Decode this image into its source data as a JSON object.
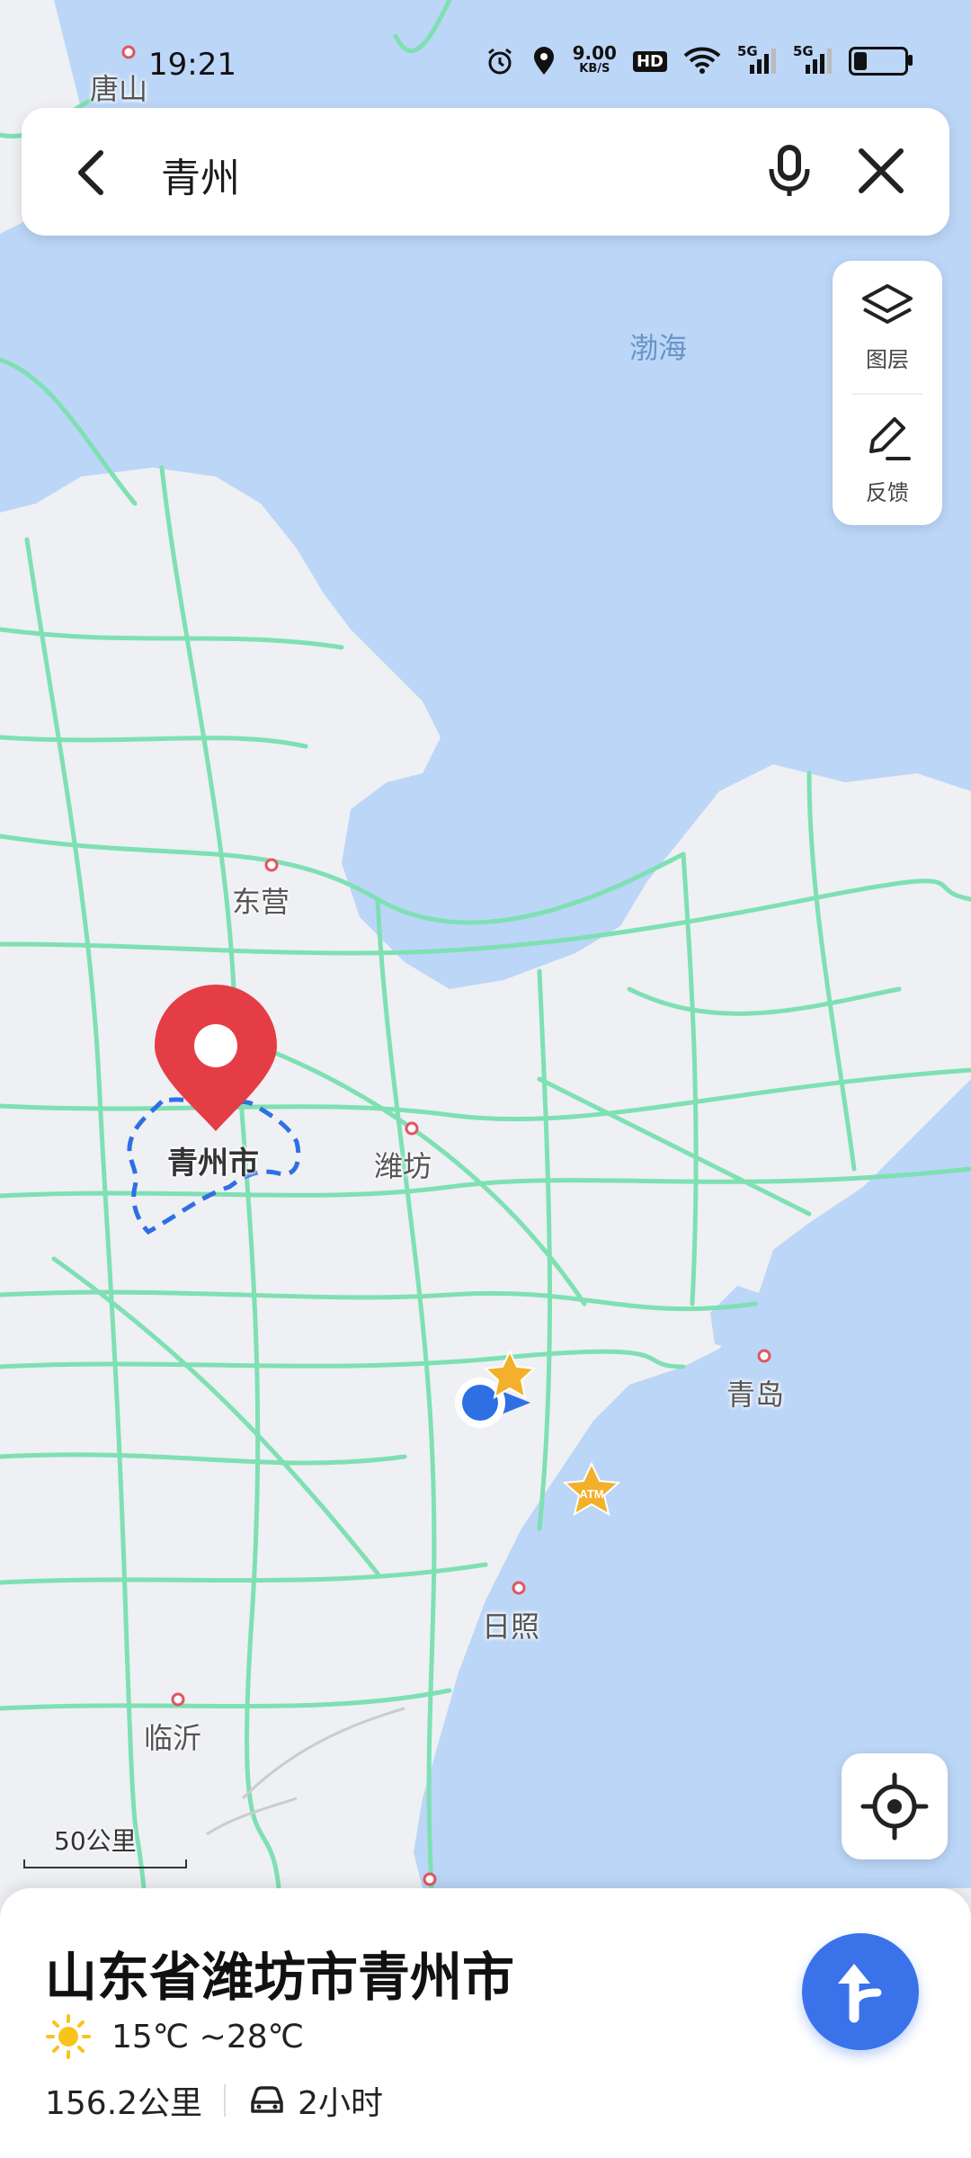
{
  "status_bar": {
    "time": "19:21",
    "net_speed_value": "9.00",
    "net_speed_unit": "KB/S",
    "hd_label": "HD",
    "network_1": "5G",
    "network_2": "5G",
    "battery_level": 0.25
  },
  "search": {
    "query": "青州"
  },
  "side_panel": {
    "layers_label": "图层",
    "feedback_label": "反馈"
  },
  "map": {
    "labels": {
      "tangshan": "唐山",
      "bohai": "渤海",
      "dongying": "东营",
      "qingzhou": "青州市",
      "weifang": "潍坊",
      "qingdao": "青岛",
      "rizhao": "日照",
      "linyi": "临沂"
    },
    "atm_badge": "ATM",
    "scale_label": "50公里",
    "colors": {
      "land": "#eef0f3",
      "sea": "#bcd6f7",
      "road": "#7ee0b3",
      "pin": "#e53d45",
      "boundary": "#2f6fe4",
      "accent": "#3a72ea"
    }
  },
  "place_card": {
    "title": "山东省潍坊市青州市",
    "weather": "15℃ ~28℃",
    "distance": "156.2公里",
    "drive_time": "2小时"
  }
}
